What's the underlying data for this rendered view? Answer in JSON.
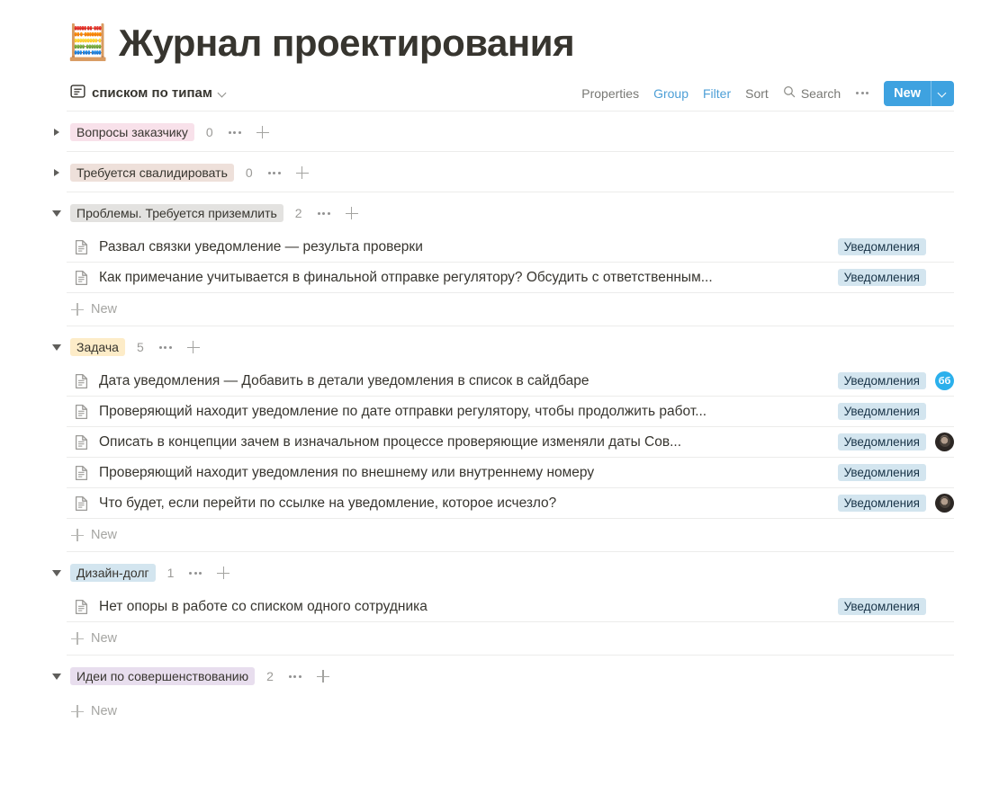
{
  "header": {
    "emoji": "🧮",
    "title": "Журнал проектирования"
  },
  "toolbar": {
    "view_icon": "list-view-icon",
    "view_name": "списком по типам",
    "properties_label": "Properties",
    "group_label": "Group",
    "filter_label": "Filter",
    "sort_label": "Sort",
    "search_label": "Search",
    "more_label": "•••",
    "new_label": "New",
    "accent_color": "#3ea2e0",
    "active_link_color": "#4d9fd6"
  },
  "new_row_label": "New",
  "groups": [
    {
      "name": "Вопросы заказчику",
      "count": "0",
      "color": "#f8e1ea",
      "expanded": false,
      "rows": []
    },
    {
      "name": "Требуется свалидировать",
      "count": "0",
      "color": "#eee0da",
      "expanded": false,
      "rows": []
    },
    {
      "name": "Проблемы. Требуется приземлить",
      "count": "2",
      "color": "#e3e2e0",
      "expanded": true,
      "rows": [
        {
          "title": "Развал связки уведомление — результа проверки",
          "tag": "Уведомления",
          "avatar": "none"
        },
        {
          "title": "Как примечание учитывается в финальной отправке регулятору? Обсудить с ответственным...",
          "tag": "Уведомления",
          "avatar": "none"
        }
      ]
    },
    {
      "name": "Задача",
      "count": "5",
      "color": "#fdecc8",
      "expanded": true,
      "rows": [
        {
          "title": "Дата уведомления — Добавить в детали уведомления в список в сайдбаре",
          "tag": "Уведомления",
          "avatar": "letter",
          "avatar_text": "бб"
        },
        {
          "title": "Проверяющий находит уведомление по дате отправки регулятору, чтобы продолжить работ...",
          "tag": "Уведомления",
          "avatar": "none"
        },
        {
          "title": "Описать в концепции зачем в изначальном процессе проверяющие изменяли даты Сов...",
          "tag": "Уведомления",
          "avatar": "photo"
        },
        {
          "title": "Проверяющий находит уведомления по внешнему или внутреннему номеру",
          "tag": "Уведомления",
          "avatar": "none"
        },
        {
          "title": "Что будет, если перейти по ссылке на уведомление, которое исчезло?",
          "tag": "Уведомления",
          "avatar": "photo"
        }
      ]
    },
    {
      "name": "Дизайн-долг",
      "count": "1",
      "color": "#d3e5ef",
      "expanded": true,
      "rows": [
        {
          "title": "Нет опоры в работе со списком одного сотрудника",
          "tag": "Уведомления",
          "avatar": "none"
        }
      ]
    },
    {
      "name": "Идеи по совершенствованию",
      "count": "2",
      "color": "#e8deee",
      "expanded": true,
      "rows": []
    }
  ]
}
